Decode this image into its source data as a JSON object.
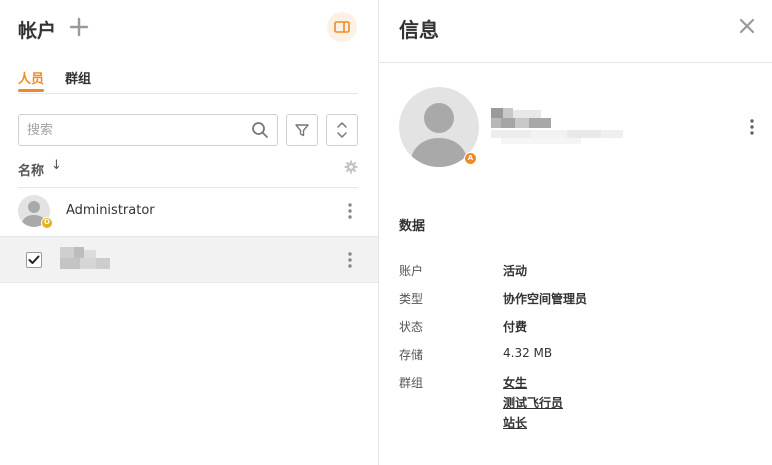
{
  "left_panel": {
    "title": "帐户",
    "tabs": [
      {
        "label": "人员",
        "active": true
      },
      {
        "label": "群组",
        "active": false
      }
    ],
    "search": {
      "placeholder": "搜索",
      "value": ""
    },
    "column": {
      "name_label": "名称",
      "sort_arrow": "↓"
    },
    "rows": [
      {
        "name": "Administrator",
        "badge": "O",
        "badge_color": "#e2b21c",
        "checked": false
      },
      {
        "name": "",
        "checked": true
      }
    ]
  },
  "right_panel": {
    "title": "信息",
    "avatar_badge": "A",
    "section_title": "数据",
    "info": [
      {
        "label": "账户",
        "value": "活动"
      },
      {
        "label": "类型",
        "value": "协作空间管理员"
      },
      {
        "label": "状态",
        "value": "付费"
      },
      {
        "label": "存储",
        "value": "4.32 MB"
      },
      {
        "label": "群组",
        "links": [
          "女生",
          "测试飞行员",
          "站长"
        ]
      }
    ]
  },
  "colors": {
    "accent": "#f08a24",
    "admin_badge": "#e2b21c",
    "selected_row": "#f2f2f2",
    "divider": "#e6e6e6",
    "icon_gray": "#9a9a9a"
  },
  "icons": {
    "add": "plus-icon",
    "panel_toggle": "panel-layout-icon",
    "search": "search-icon",
    "filter": "filter-icon",
    "sort": "sort-icon",
    "settings": "gear-icon",
    "more": "more-vertical-icon",
    "close": "close-icon",
    "check": "check-icon"
  }
}
